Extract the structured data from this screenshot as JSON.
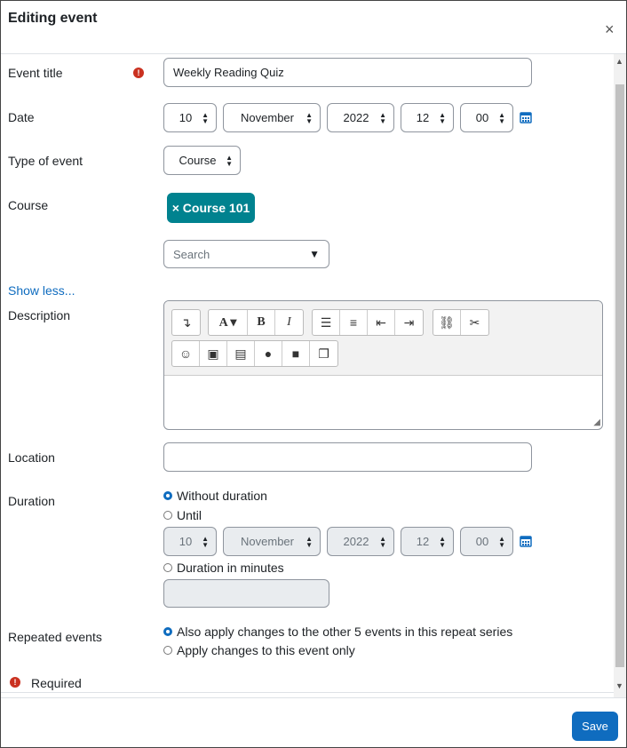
{
  "header": {
    "title": "Editing event",
    "close_label": "×"
  },
  "form": {
    "event_title": {
      "label": "Event title",
      "value": "Weekly Reading Quiz"
    },
    "date": {
      "label": "Date",
      "day": "10",
      "month": "November",
      "year": "2022",
      "hour": "12",
      "minute": "00"
    },
    "type_of_event": {
      "label": "Type of event",
      "value": "Course"
    },
    "course": {
      "label": "Course",
      "selected": "× Course 101",
      "search_placeholder": "Search"
    },
    "show_less": "Show less...",
    "description": {
      "label": "Description"
    },
    "location": {
      "label": "Location",
      "value": ""
    },
    "duration": {
      "label": "Duration",
      "without": "Without duration",
      "until": "Until",
      "day": "10",
      "month": "November",
      "year": "2022",
      "hour": "12",
      "minute": "00",
      "in_minutes": "Duration in minutes"
    },
    "repeated": {
      "label": "Repeated events",
      "option_all": "Also apply changes to the other 5 events in this repeat series",
      "option_one": "Apply changes to this event only"
    },
    "required_note": "Required"
  },
  "footer": {
    "save_label": "Save"
  },
  "colors": {
    "accent": "#0f6cbf",
    "badge": "#00828f",
    "required": "#ca3120"
  }
}
